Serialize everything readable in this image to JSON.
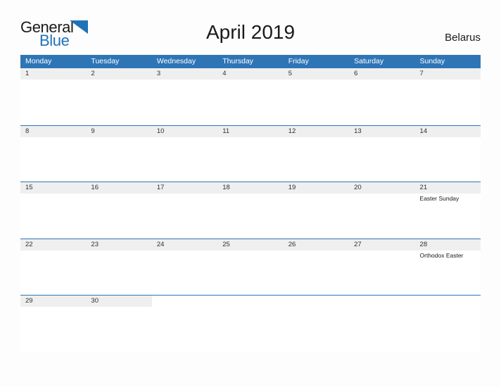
{
  "brand": {
    "word_one": "General",
    "word_two": "Blue",
    "flag_icon": "blue-triangle-flag-icon",
    "accent_color": "#2072b8"
  },
  "header": {
    "title": "April 2019",
    "region": "Belarus"
  },
  "colors": {
    "weekday_header_bg": "#2e75b6",
    "weekday_header_text": "#ffffff",
    "date_band_bg": "#efefef",
    "row_border": "#2e75b6",
    "page_bg": "#fdfdfd",
    "body_text": "#1a1a1a"
  },
  "calendar": {
    "weekdays": [
      "Monday",
      "Tuesday",
      "Wednesday",
      "Thursday",
      "Friday",
      "Saturday",
      "Sunday"
    ],
    "weeks": [
      {
        "days": [
          {
            "date": "1",
            "event": ""
          },
          {
            "date": "2",
            "event": ""
          },
          {
            "date": "3",
            "event": ""
          },
          {
            "date": "4",
            "event": ""
          },
          {
            "date": "5",
            "event": ""
          },
          {
            "date": "6",
            "event": ""
          },
          {
            "date": "7",
            "event": ""
          }
        ]
      },
      {
        "days": [
          {
            "date": "8",
            "event": ""
          },
          {
            "date": "9",
            "event": ""
          },
          {
            "date": "10",
            "event": ""
          },
          {
            "date": "11",
            "event": ""
          },
          {
            "date": "12",
            "event": ""
          },
          {
            "date": "13",
            "event": ""
          },
          {
            "date": "14",
            "event": ""
          }
        ]
      },
      {
        "days": [
          {
            "date": "15",
            "event": ""
          },
          {
            "date": "16",
            "event": ""
          },
          {
            "date": "17",
            "event": ""
          },
          {
            "date": "18",
            "event": ""
          },
          {
            "date": "19",
            "event": ""
          },
          {
            "date": "20",
            "event": ""
          },
          {
            "date": "21",
            "event": "Easter Sunday"
          }
        ]
      },
      {
        "days": [
          {
            "date": "22",
            "event": ""
          },
          {
            "date": "23",
            "event": ""
          },
          {
            "date": "24",
            "event": ""
          },
          {
            "date": "25",
            "event": ""
          },
          {
            "date": "26",
            "event": ""
          },
          {
            "date": "27",
            "event": ""
          },
          {
            "date": "28",
            "event": "Orthodox Easter"
          }
        ]
      },
      {
        "days": [
          {
            "date": "29",
            "event": ""
          },
          {
            "date": "30",
            "event": ""
          },
          {
            "date": "",
            "event": ""
          },
          {
            "date": "",
            "event": ""
          },
          {
            "date": "",
            "event": ""
          },
          {
            "date": "",
            "event": ""
          },
          {
            "date": "",
            "event": ""
          }
        ]
      }
    ]
  }
}
